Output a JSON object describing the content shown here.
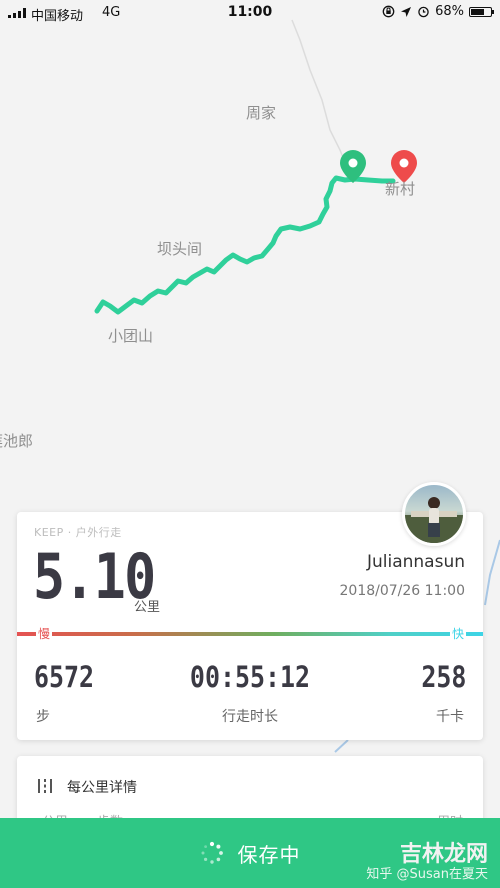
{
  "status_bar": {
    "carrier": "中国移动",
    "network": "4G",
    "time": "11:00",
    "battery": "68%",
    "battery_level": 0.68
  },
  "map": {
    "places": [
      "周家",
      "新村",
      "坝头间",
      "小团山",
      "莲池郎"
    ],
    "route_color": "#2fd09a",
    "start_marker_color": "#2ebf7e",
    "end_marker_color": "#ee4b4b"
  },
  "summary": {
    "brand": "KEEP · 户外行走",
    "distance": "5.10",
    "distance_unit": "公里",
    "username": "Juliannasun",
    "datetime": "2018/07/26 11:00",
    "pace_slow": "慢",
    "pace_fast": "快",
    "stats": {
      "steps_value": "6572",
      "steps_label": "步",
      "time_value": "00:55:12",
      "time_label": "行走时长",
      "calories_value": "258",
      "calories_label": "千卡"
    }
  },
  "detail": {
    "title": "每公里详情",
    "columns": [
      "公里",
      "步数",
      "用时"
    ]
  },
  "save_bar": {
    "label": "保存中"
  },
  "watermark": {
    "logo": "吉林龙网",
    "author": "知乎 @Susan在夏天"
  },
  "colors": {
    "accent_green": "#2fc785",
    "slow_red": "#e55252",
    "fast_cyan": "#3dd4e6"
  }
}
